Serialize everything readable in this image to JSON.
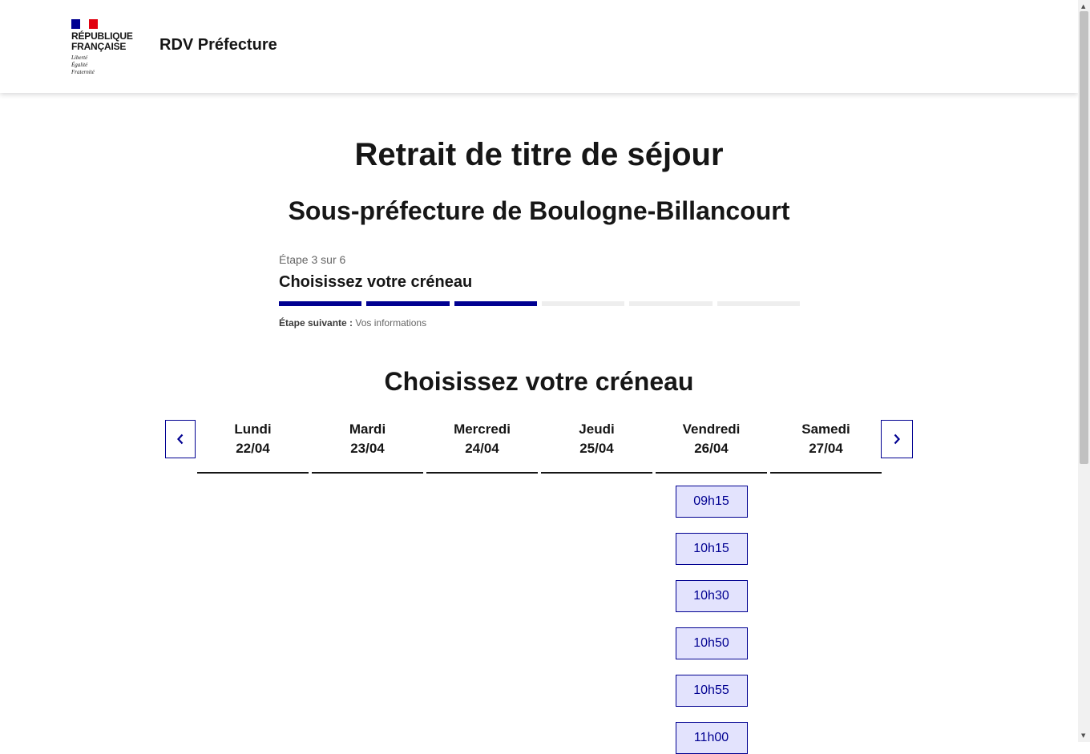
{
  "header": {
    "logo_lines": [
      "RÉPUBLIQUE",
      "FRANÇAISE"
    ],
    "motto_lines": [
      "Liberté",
      "Égalité",
      "Fraternité"
    ],
    "site_title": "RDV Préfecture"
  },
  "page": {
    "title": "Retrait de titre de séjour",
    "subtitle": "Sous-préfecture de Boulogne-Billancourt"
  },
  "stepper": {
    "state": "Étape 3 sur 6",
    "title": "Choisissez votre créneau",
    "total_steps": 6,
    "current_step": 3,
    "next_label": "Étape suivante :",
    "next_value": "Vos informations"
  },
  "calendar": {
    "title": "Choisissez votre créneau",
    "days": [
      {
        "name": "Lundi",
        "date": "22/04",
        "slots": []
      },
      {
        "name": "Mardi",
        "date": "23/04",
        "slots": []
      },
      {
        "name": "Mercredi",
        "date": "24/04",
        "slots": []
      },
      {
        "name": "Jeudi",
        "date": "25/04",
        "slots": []
      },
      {
        "name": "Vendredi",
        "date": "26/04",
        "slots": [
          "09h15",
          "10h15",
          "10h30",
          "10h50",
          "10h55",
          "11h00"
        ]
      },
      {
        "name": "Samedi",
        "date": "27/04",
        "slots": []
      }
    ]
  },
  "icons": {
    "prev": "chevron-left-icon",
    "next": "chevron-right-icon"
  },
  "colors": {
    "primary": "#000091",
    "slot_bg": "#e3e3fd",
    "flag_blue": "#000091",
    "flag_red": "#e1000f"
  }
}
